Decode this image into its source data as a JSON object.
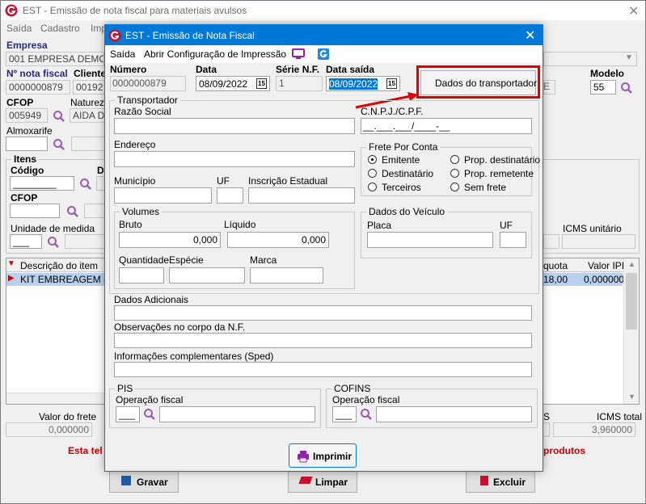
{
  "main": {
    "title": "EST - Emissão de nota fiscal para materiais avulsos",
    "menu": [
      "Saída",
      "Cadastro",
      "Imp"
    ],
    "empresa_label": "Empresa",
    "empresa_value": "001 EMPRESA DEMONS",
    "nf_label": "Nº nota fiscal",
    "nf_value": "0000000879",
    "cliente_label": "Cliente",
    "cliente_value": "00192",
    "modelo_label": "Modelo",
    "modelo_value": "55",
    "cfop_label": "CFOP",
    "cfop_value": "005949",
    "natureza_label": "Naturez",
    "natureza_value": "AIDA DE",
    "almox_label": "Almoxarife",
    "itens_label": "Itens",
    "codigo_label": "Código",
    "codigo_value": "________",
    "cfop2_label": "CFOP",
    "unidade_label": "Unidade de medida",
    "unidade_value": "___",
    "icms_unit_label": "ICMS unitário",
    "grid_col_desc": "Descrição do item",
    "grid_col_aliq": "quota",
    "grid_col_ipi": "Valor IPI",
    "grid_row_desc": "KIT EMBREAGEM (P",
    "grid_row_aliq": "18,00",
    "grid_row_ipi": "0,000000",
    "frete_label": "Valor do frete",
    "frete_value": "0,000000",
    "icms_total_label": "ICMS total",
    "icms_total_value": "3,960000",
    "s_label": "S",
    "warning_left": "Esta tel",
    "warning_right": "produtos",
    "gravar": "Gravar",
    "limpar": "Limpar",
    "excluir": "Excluir"
  },
  "dialog": {
    "title": "EST - Emissão de Nota Fiscal",
    "menu_saida": "Saída",
    "menu_config": "Abrir Configuração de Impressão",
    "numero_label": "Número",
    "numero_value": "0000000879",
    "data_label": "Data",
    "data_value": "08/09/2022",
    "serie_label": "Série N.F.",
    "serie_value": "1",
    "datasaida_label": "Data saída",
    "datasaida_value": "08/09/2022",
    "cal_icon": "15",
    "dados_transportador": "Dados do transportador",
    "transportador_group": "Transportador",
    "razao_label": "Razão Social",
    "cnpj_label": "C.N.P.J./C.P.F.",
    "cnpj_value": "__.___.___/____-__",
    "endereco_label": "Endereço",
    "frete_group": "Frete Por Conta",
    "frete_options": [
      "Emitente",
      "Destinatário",
      "Terceiros",
      "Prop. destinatário",
      "Prop. remetente",
      "Sem frete"
    ],
    "municipio_label": "Município",
    "uf_label": "UF",
    "ie_label": "Inscrição Estadual",
    "volumes_group": "Volumes",
    "bruto_label": "Bruto",
    "bruto_value": "0,000",
    "liquido_label": "Líquido",
    "liquido_value": "0,000",
    "quantidade_label": "Quantidade",
    "especie_label": "Espécie",
    "marca_label": "Marca",
    "veiculo_group": "Dados do Veículo",
    "placa_label": "Placa",
    "uf2_label": "UF",
    "dados_adicionais_label": "Dados Adicionais",
    "obs_label": "Observações no corpo da N.F.",
    "info_label": "Informações complementares (Sped)",
    "pis_group": "PIS",
    "pis_op_label": "Operação fiscal",
    "pis_op_value": "___",
    "cofins_group": "COFINS",
    "cofins_op_label": "Operação fiscal",
    "cofins_op_value": "___",
    "imprimir": "Imprimir"
  },
  "colors": {
    "highlight": "#e00000",
    "accent": "#0078d7",
    "warning": "#cc0000"
  }
}
